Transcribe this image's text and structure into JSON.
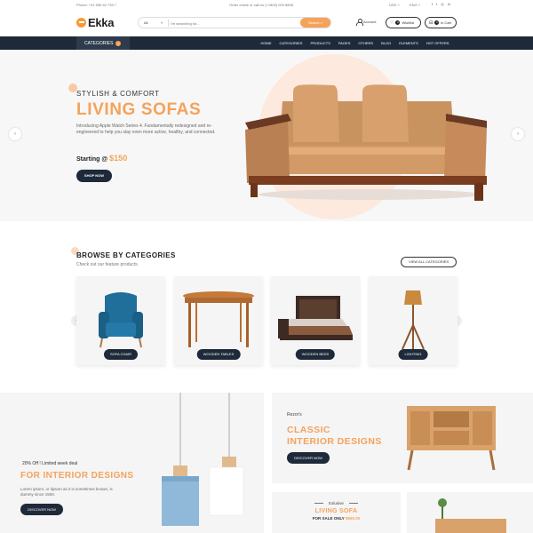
{
  "topbar": {
    "phone": "Phone: +91 555 62 739 7",
    "promo": "Order online or call us (+1800) 000 8808",
    "currency": "USD",
    "language": "ENG",
    "social": [
      "f",
      "t",
      "◎",
      "in"
    ]
  },
  "header": {
    "logo": "Ekka",
    "search_category": "All",
    "search_placeholder": "I'm searching for...",
    "search_button": "Search",
    "account": "Account",
    "wishlist": "Wishlist",
    "wishlist_count": "0",
    "cart": "in Cart",
    "cart_count": "0"
  },
  "nav": {
    "categories": "CATEGORIES",
    "categories_badge": "+",
    "items": [
      "HOME",
      "CATEGORIES",
      "PRODUCTS",
      "PAGES",
      "OTHERS",
      "BLOG",
      "ELEMENTS",
      "HOT OFFERS"
    ]
  },
  "hero": {
    "eyebrow": "STYLISH & COMFORT",
    "title": "LIVING SOFAS",
    "description": "Introducing Apple Watch Series 4. Fundamentally redesigned and re-engineered to help you stay even more active, healthy, and connected.",
    "starting_label": "Starting @",
    "price": "$150",
    "button": "SHOP NOW"
  },
  "categories": {
    "title": "BROWSE BY CATEGORIES",
    "subtitle": "Check out our feature products.",
    "view_all": "VIEW ALL CATEGORIES",
    "items": [
      {
        "label": "SOFA CHAIR"
      },
      {
        "label": "WOODEN TABLES"
      },
      {
        "label": "WOODEN BEDS"
      },
      {
        "label": "LIGHTING"
      }
    ]
  },
  "banners": {
    "left": {
      "offer": "20% Off ! Limited week deal",
      "title": "FOR INTERIOR DESIGNS",
      "description": "Lorem ipsum, or lipsum as it is sometimes known, is dummy since 1500.",
      "button": "DISCOVER NOW"
    },
    "right": {
      "brand": "Rezor's",
      "title_line1": "CLASSIC",
      "title_line2": "INTERIOR DESIGNS",
      "button": "DISCOVER NOW"
    },
    "small": {
      "exclusive": "Exlusive",
      "title": "LIVING SOFA",
      "sale_label": "FOR SALE ONLY",
      "sale_price": "$590.00"
    }
  },
  "colors": {
    "accent": "#f5a25b",
    "dark": "#1e2a3a"
  }
}
